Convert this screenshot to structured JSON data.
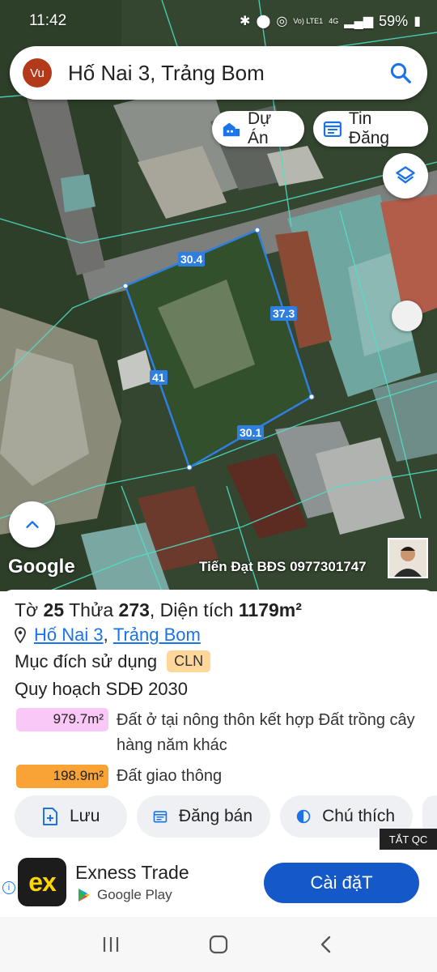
{
  "status": {
    "time": "11:42",
    "volte": "Vo) LTE1",
    "network": "4G",
    "battery": "59%"
  },
  "search": {
    "avatar_initials": "Vu",
    "query": "Hố Nai 3, Trảng Bom"
  },
  "map": {
    "chips": {
      "du_an": "Dự Án",
      "tin_dang": "Tin Đăng"
    },
    "measurements": {
      "top": "30.4",
      "right": "37.3",
      "left": "41",
      "bottom": "30.1"
    },
    "google_logo": "Google",
    "watermark": "Tiến Đạt BĐS 0977301747"
  },
  "parcel": {
    "title_prefix": "Tờ",
    "sheet_no": "25",
    "plot_label": "Thửa",
    "plot_no": "273",
    "area_label": ", Diện tích",
    "area_value": "1179m²",
    "location_ward": "Hố Nai 3",
    "location_sep": ",",
    "location_district": "Trảng Bom",
    "usage_label": "Mục đích sử dụng",
    "usage_code": "CLN",
    "plan_label": "Quy hoạch SDĐ 2030",
    "zones": [
      {
        "area": "979.7m²",
        "desc": "Đất ở tại nông thôn kết hợp Đất trồng cây hàng năm khác",
        "color": "#f9c8f7"
      },
      {
        "area": "198.9m²",
        "desc": "Đất giao thông",
        "color": "#f9a235"
      }
    ]
  },
  "actions": {
    "save": "Lưu",
    "post_sale": "Đăng bán",
    "legend": "Chú thích"
  },
  "ad": {
    "close_label": "TẮT QC",
    "logo_text": "ex",
    "title": "Exness Trade",
    "store": "Google Play",
    "install": "Cài đặT"
  },
  "colors": {
    "accent": "#1a73e8",
    "boundary": "#2e7fe0",
    "install": "#1559c9"
  }
}
